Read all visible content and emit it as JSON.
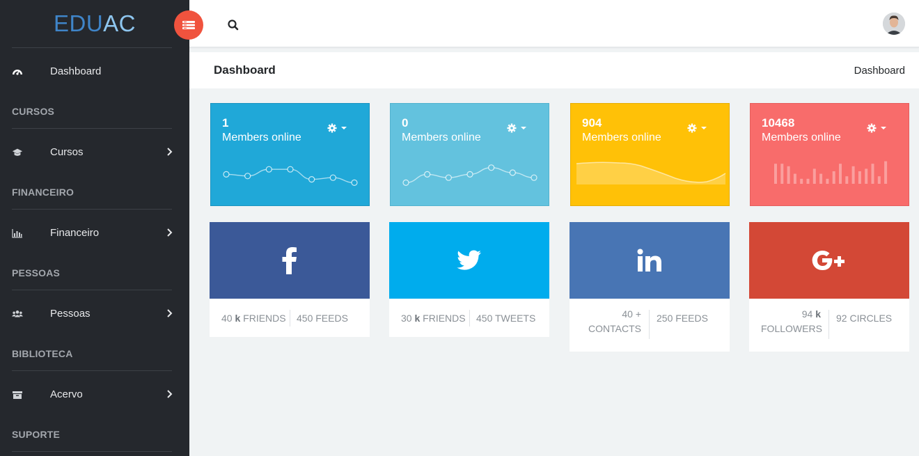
{
  "brand": {
    "part1": "EDU",
    "part2": "AC"
  },
  "sidebar": {
    "items": [
      {
        "label": "Dashboard",
        "icon": "dashboard-icon"
      },
      {
        "section": "CURSOS",
        "label": "Cursos",
        "icon": "graduation-cap-icon"
      },
      {
        "section": "FINANCEIRO",
        "label": "Financeiro",
        "icon": "bar-chart-icon"
      },
      {
        "section": "PESSOAS",
        "label": "Pessoas",
        "icon": "users-icon"
      },
      {
        "section": "BIBLIOTECA",
        "label": "Acervo",
        "icon": "archive-icon"
      },
      {
        "section": "SUPORTE"
      }
    ]
  },
  "header": {
    "page_title": "Dashboard",
    "breadcrumb": "Dashboard"
  },
  "stats": [
    {
      "value": "1",
      "label": "Members online",
      "color": "#20a8d8",
      "chart": "line",
      "points": [
        0.3,
        0.35,
        0.15,
        0.15,
        0.45,
        0.4,
        0.55
      ]
    },
    {
      "value": "0",
      "label": "Members online",
      "color": "#63c2de",
      "chart": "line",
      "points": [
        0.55,
        0.3,
        0.4,
        0.3,
        0.1,
        0.25,
        0.4
      ]
    },
    {
      "value": "904",
      "label": "Members online",
      "color": "#ffc107",
      "chart": "area"
    },
    {
      "value": "10468",
      "label": "Members online",
      "color": "#f86c6b",
      "chart": "bar",
      "points": [
        0.8,
        0.8,
        0.7,
        0.4,
        0.2,
        0.2,
        0.6,
        0.4,
        0.2,
        0.5,
        0.8,
        0.3,
        0.7,
        0.5,
        0.6,
        0.8,
        0.3,
        0.9
      ]
    }
  ],
  "social": [
    {
      "network": "facebook",
      "icon": "facebook-icon",
      "color": "#3b5998",
      "col1_num": "40",
      "col1_unit": "k",
      "col1_text": "FRIENDS",
      "col2": "450 FEEDS"
    },
    {
      "network": "twitter",
      "icon": "twitter-icon",
      "color": "#00aced",
      "col1_num": "30",
      "col1_unit": "k",
      "col1_text": "FRIENDS",
      "col2": "450 TWEETS"
    },
    {
      "network": "linkedin",
      "icon": "linkedin-icon",
      "color": "#4875b4",
      "col1_num": "40 +",
      "col1_unit": "",
      "col1_text": "CONTACTS",
      "col2": "250 FEEDS"
    },
    {
      "network": "google-plus",
      "icon": "google-plus-icon",
      "color": "#d34836",
      "col1_num": "94",
      "col1_unit": "k",
      "col1_text": "FOLLOWERS",
      "col2": "92 CIRCLES"
    }
  ]
}
